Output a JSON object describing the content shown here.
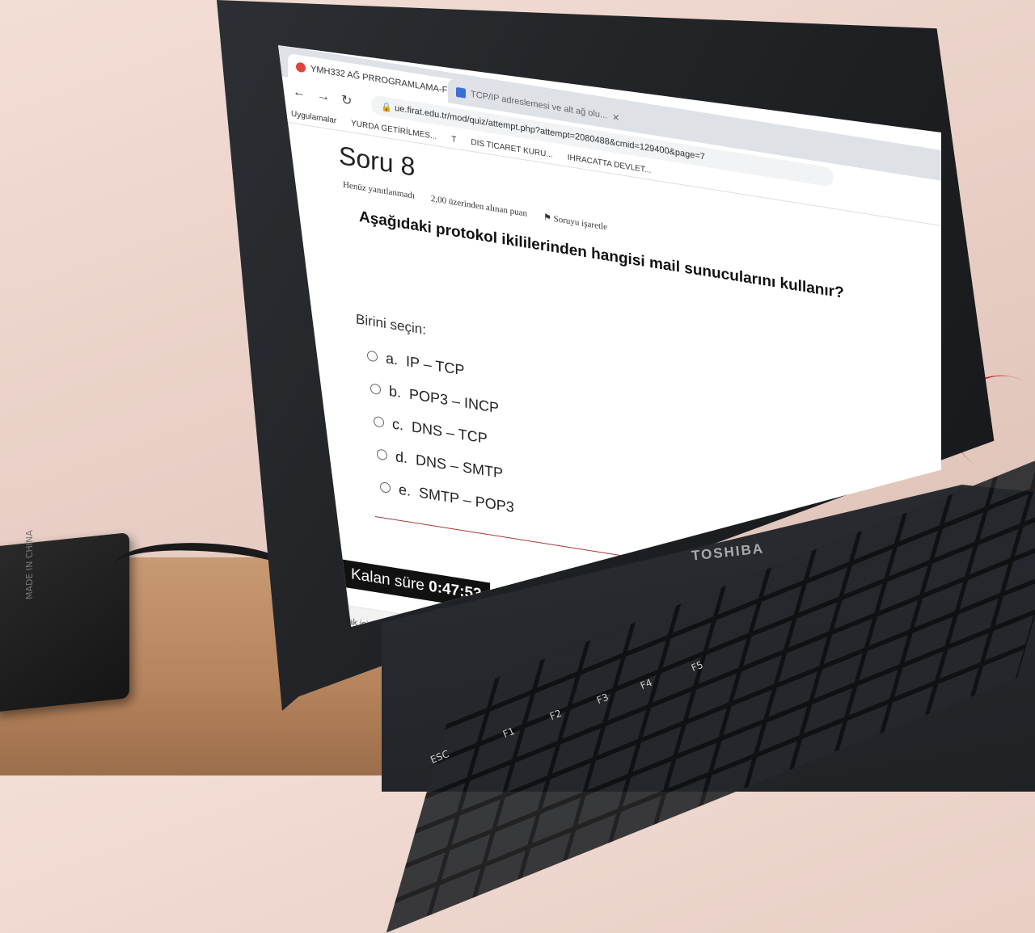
{
  "browser": {
    "tabs": [
      {
        "label": "YMH332 AĞ PRROGRAMLAMA-F",
        "active": true
      },
      {
        "label": "TCP/IP adreslemesi ve alt ağ olu...",
        "active": false
      }
    ],
    "url": "ue.firat.edu.tr/mod/quiz/attempt.php?attempt=2080488&cmid=129400&page=7",
    "bookmarks": [
      "Uygulamalar",
      "YURDA GETİRİLMES...",
      "T",
      "DIS TICARET KURU...",
      "IHRACATTA DEVLET..."
    ]
  },
  "quiz": {
    "title": "Soru 8",
    "status": "Henüz yanıtlanmadı",
    "points": "2,00 üzerinden alınan puan",
    "flag": "Soruyu işaretle",
    "question": "Aşağıdaki protokol ikililerinden hangisi mail sunucularını kullanır?",
    "choose_label": "Birini seçin:",
    "options": [
      {
        "letter": "a.",
        "text": "IP – TCP"
      },
      {
        "letter": "b.",
        "text": "POP3 – INCP"
      },
      {
        "letter": "c.",
        "text": "DNS – TCP"
      },
      {
        "letter": "d.",
        "text": "DNS – SMTP"
      },
      {
        "letter": "e.",
        "text": "SMTP – POP3"
      }
    ],
    "timer_label": "Kalan süre",
    "timer_value": "0:47:53"
  },
  "taskbar": {
    "search_placeholder": "Aramak için buraya yazın"
  },
  "laptop": {
    "brand": "TOSHIBA",
    "keys": [
      "ESC",
      "F1",
      "F2",
      "F3",
      "F4",
      "F5"
    ]
  },
  "adapter": {
    "label": "MADE IN CHINA"
  },
  "colors": {
    "wall": "#e9cfc6",
    "desk": "#b5835c",
    "laptop": "#1f2225",
    "cable_red": "#c0262b",
    "quiz_accent": "#6a2f57"
  }
}
